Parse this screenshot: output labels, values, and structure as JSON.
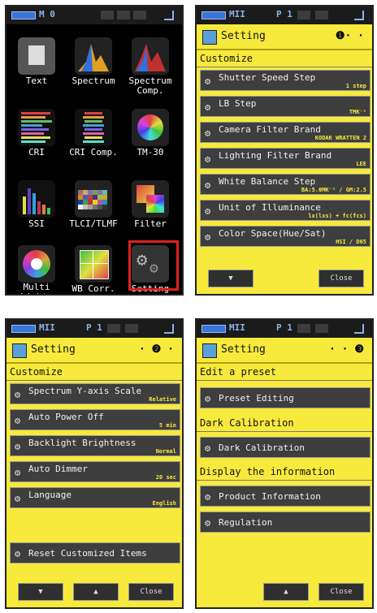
{
  "screen1": {
    "status_label": "M 0",
    "tiles": [
      {
        "label": "Text",
        "icon": "text-icon"
      },
      {
        "label": "Spectrum",
        "icon": "spectrum-icon"
      },
      {
        "label": "Spectrum\nComp.",
        "icon": "spectrum-comp-icon"
      },
      {
        "label": "CRI",
        "icon": "cri-icon"
      },
      {
        "label": "CRI Comp.",
        "icon": "cri-comp-icon"
      },
      {
        "label": "TM-30",
        "icon": "tm30-icon"
      },
      {
        "label": "SSI",
        "icon": "ssi-icon"
      },
      {
        "label": "TLCI/TLMF",
        "icon": "tlci-icon"
      },
      {
        "label": "Filter",
        "icon": "filter-icon"
      },
      {
        "label": "Multi\nLights",
        "icon": "multi-lights-icon"
      },
      {
        "label": "WB Corr.",
        "icon": "wb-corr-icon"
      },
      {
        "label": "Setting",
        "icon": "setting-icon"
      }
    ],
    "highlight_color": "#e02020"
  },
  "screen2": {
    "status_left": "MII",
    "status_mid": "P 1",
    "title": "Setting",
    "page": "❶· ·",
    "section": "Customize",
    "items": [
      {
        "name": "Shutter Speed Step",
        "value": "1 step"
      },
      {
        "name": "LB Step",
        "value": "TMK⁻¹"
      },
      {
        "name": "Camera Filter Brand",
        "value": "KODAK WRATTEN 2"
      },
      {
        "name": "Lighting Filter Brand",
        "value": "LEE"
      },
      {
        "name": "White Balance Step",
        "value": "BA:5.0MK⁻¹ / GM:2.5"
      },
      {
        "name": "Unit of Illuminance",
        "value": "lx(lxs) + fc(fcs)"
      },
      {
        "name": "Color Space(Hue/Sat)",
        "value": "HSI / D65"
      }
    ],
    "btn_down": "▼",
    "btn_close": "Close"
  },
  "screen3": {
    "status_left": "MII",
    "status_mid": "P 1",
    "title": "Setting",
    "page": "· ❷ ·",
    "section": "Customize",
    "items": [
      {
        "name": "Spectrum Y-axis Scale",
        "value": "Relative"
      },
      {
        "name": "Auto Power Off",
        "value": "5 min"
      },
      {
        "name": "Backlight Brightness",
        "value": "Normal"
      },
      {
        "name": "Auto Dimmer",
        "value": "20 sec"
      },
      {
        "name": "Language",
        "value": "English"
      }
    ],
    "reset_item": "Reset Customized Items",
    "btn_down": "▼",
    "btn_up": "▲",
    "btn_close": "Close"
  },
  "screen4": {
    "status_left": "MII",
    "status_mid": "P 1",
    "title": "Setting",
    "page": "· · ❸",
    "sections": [
      {
        "title": "Edit a preset",
        "item": "Preset Editing"
      },
      {
        "title": "Dark Calibration",
        "item": "Dark Calibration"
      },
      {
        "title": "Display the information",
        "item": "Product Information"
      }
    ],
    "extra_item": "Regulation",
    "btn_up": "▲",
    "btn_close": "Close"
  }
}
